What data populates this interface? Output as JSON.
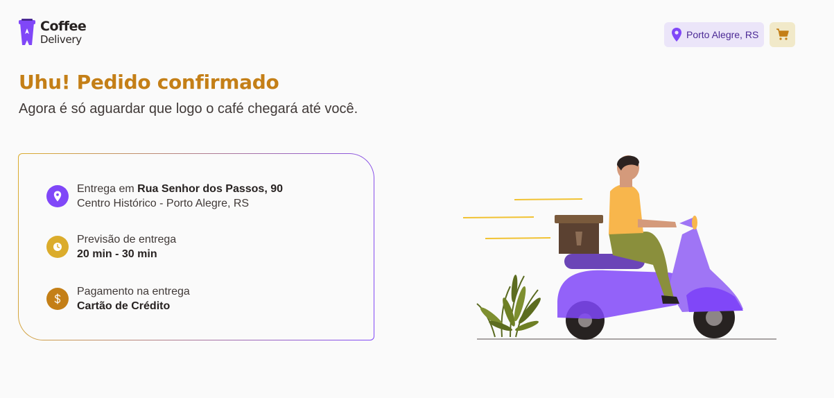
{
  "header": {
    "logo_line1": "Coffee",
    "logo_line2": "Delivery",
    "location_label": "Porto Alegre, RS",
    "location_icon": "map-pin-icon",
    "cart_icon": "shopping-cart-icon"
  },
  "main": {
    "title": "Uhu! Pedido confirmado",
    "subtitle": "Agora é só aguardar que logo o café chegará até você."
  },
  "order_info": {
    "address_prefix": "Entrega em ",
    "address_street": "Rua Senhor dos Passos, 90",
    "address_district": "Centro Histórico - Porto Alegre, RS",
    "delivery_label": "Previsão de entrega",
    "delivery_time": "20 min - 30 min",
    "payment_label": "Pagamento na entrega",
    "payment_method": "Cartão de Crédito"
  },
  "colors": {
    "title": "#C47F17",
    "purple": "#8047F8",
    "yellow": "#DBAC2C",
    "brown": "#C47F17",
    "location_bg": "#EBE5F9",
    "cart_bg": "#F1E9C9"
  }
}
